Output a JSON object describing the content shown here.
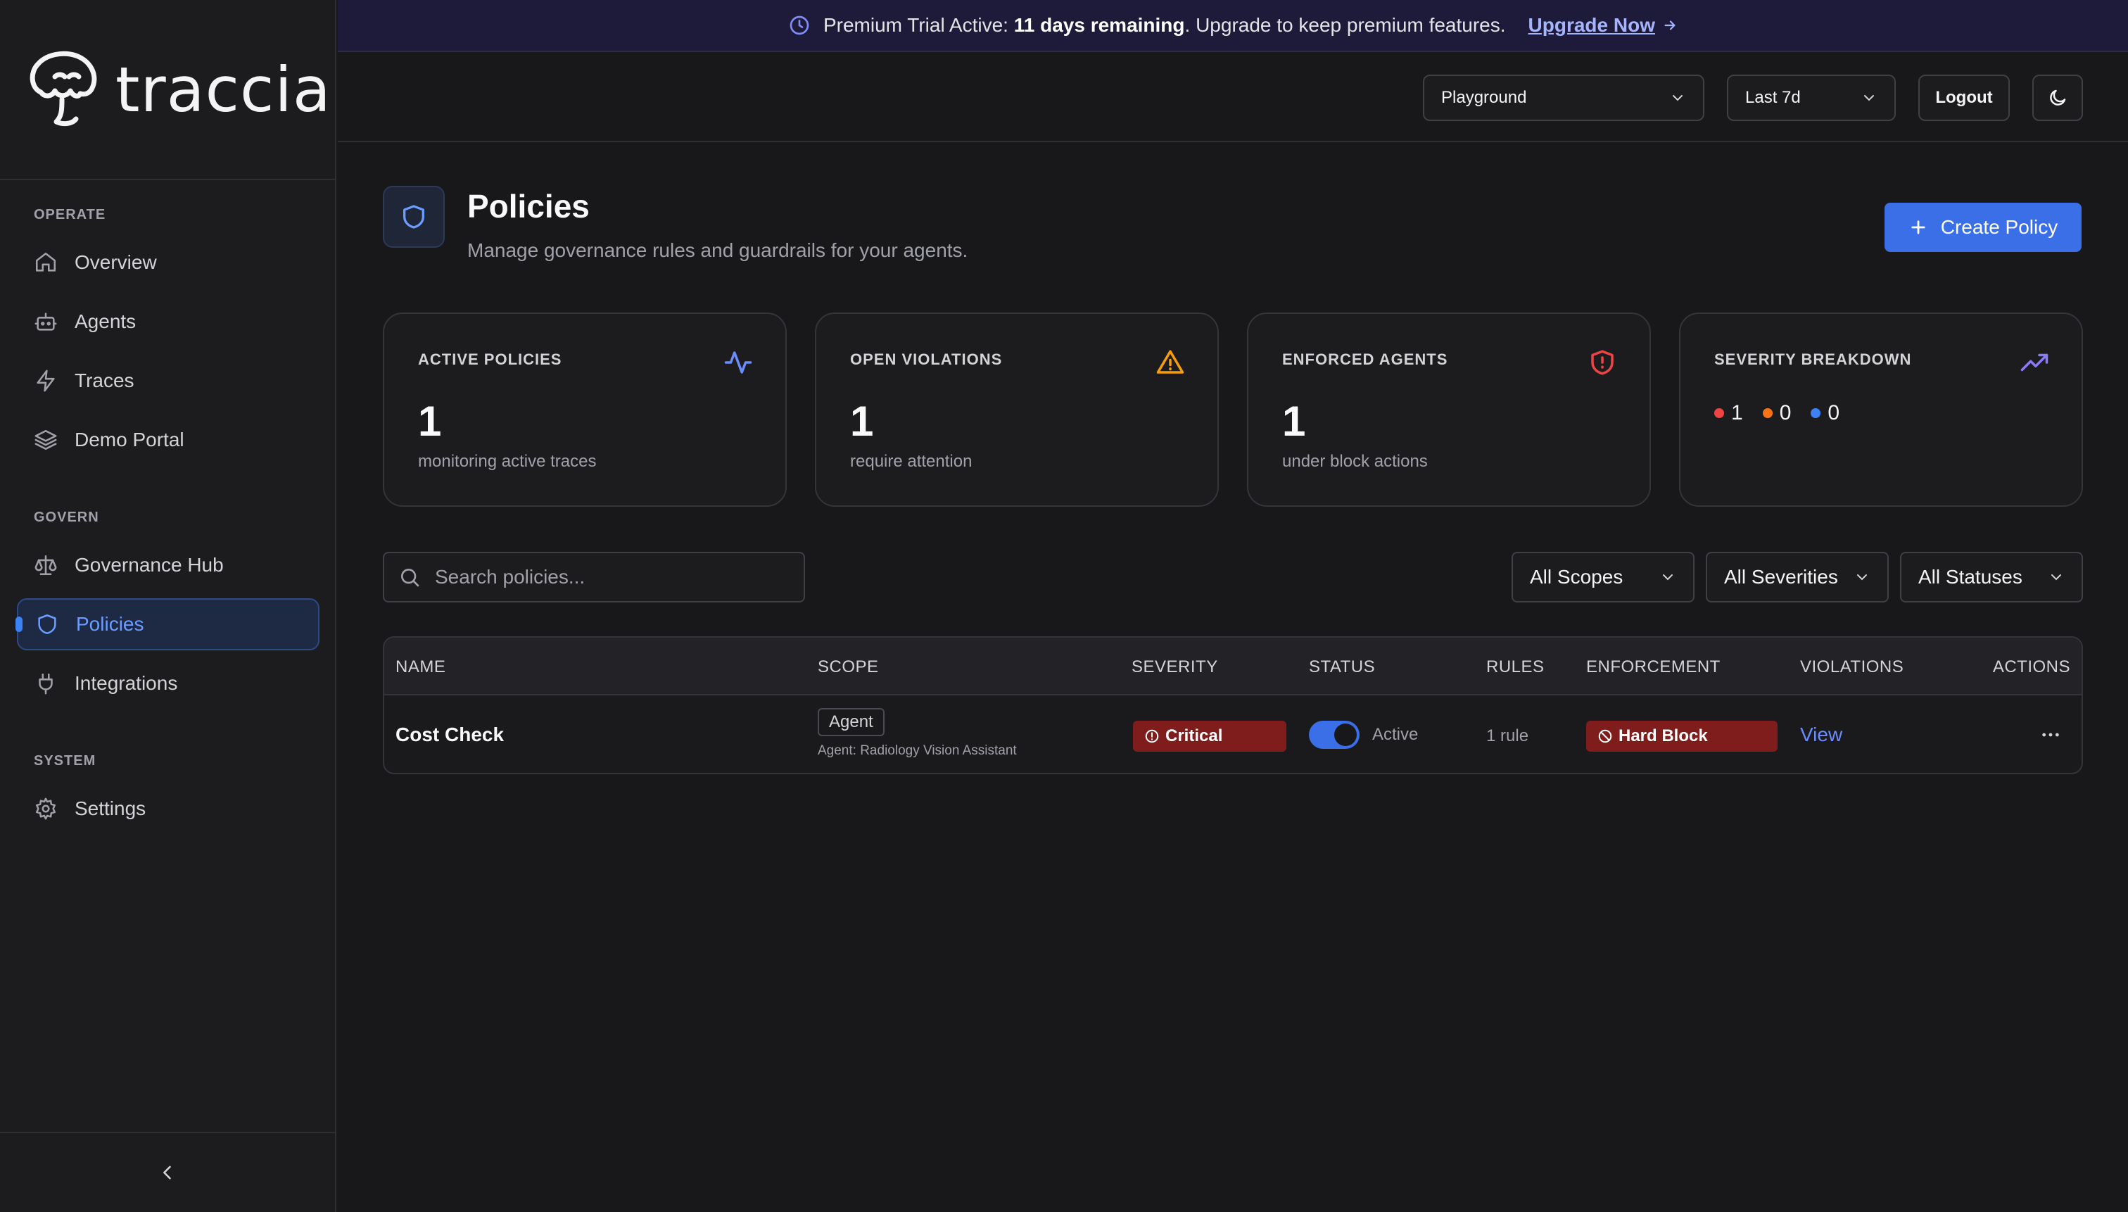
{
  "app": {
    "name": "traccia"
  },
  "banner": {
    "prefix": "Premium Trial Active: ",
    "days": "11 days remaining",
    "suffix": ". Upgrade to keep premium features.",
    "upgrade_label": "Upgrade Now"
  },
  "topbar": {
    "project": "Playground",
    "range": "Last 7d",
    "logout_label": "Logout"
  },
  "sidebar": {
    "sections": [
      {
        "label": "OPERATE",
        "items": [
          {
            "label": "Overview",
            "icon": "home-icon"
          },
          {
            "label": "Agents",
            "icon": "bot-icon"
          },
          {
            "label": "Traces",
            "icon": "lightning-icon"
          },
          {
            "label": "Demo Portal",
            "icon": "layers-icon"
          }
        ]
      },
      {
        "label": "GOVERN",
        "items": [
          {
            "label": "Governance Hub",
            "icon": "scale-icon"
          },
          {
            "label": "Policies",
            "icon": "shield-icon",
            "active": true
          },
          {
            "label": "Integrations",
            "icon": "plug-icon"
          }
        ]
      },
      {
        "label": "SYSTEM",
        "items": [
          {
            "label": "Settings",
            "icon": "gear-icon"
          }
        ]
      }
    ]
  },
  "page": {
    "title": "Policies",
    "subtitle": "Manage governance rules and guardrails for your agents.",
    "create_label": "Create Policy"
  },
  "stats": [
    {
      "label": "ACTIVE POLICIES",
      "value": "1",
      "sub": "monitoring active traces",
      "icon": "activity-icon",
      "color": "#6b8cff"
    },
    {
      "label": "OPEN VIOLATIONS",
      "value": "1",
      "sub": "require attention",
      "icon": "warning-icon",
      "color": "#f59e0b"
    },
    {
      "label": "ENFORCED AGENTS",
      "value": "1",
      "sub": "under block actions",
      "icon": "shield-alert-icon",
      "color": "#ef4444"
    },
    {
      "label": "SEVERITY BREAKDOWN",
      "icon": "trending-up-icon",
      "color": "#8b7cf6",
      "breakdown": [
        {
          "count": "1",
          "color": "#ef4444"
        },
        {
          "count": "0",
          "color": "#f97316"
        },
        {
          "count": "0",
          "color": "#3b82f6"
        }
      ]
    }
  ],
  "search": {
    "placeholder": "Search policies..."
  },
  "filters": [
    "All Scopes",
    "All Severities",
    "All Statuses"
  ],
  "table": {
    "columns": [
      "NAME",
      "SCOPE",
      "SEVERITY",
      "STATUS",
      "RULES",
      "ENFORCEMENT",
      "VIOLATIONS",
      "ACTIONS"
    ],
    "rows": [
      {
        "name": "Cost Check",
        "scope": "Agent",
        "scope_detail": "Agent: Radiology Vision Assistant",
        "severity": "Critical",
        "status": "Active",
        "status_on": true,
        "rules": "1 rule",
        "enforcement": "Hard Block",
        "violations": "View"
      }
    ]
  }
}
